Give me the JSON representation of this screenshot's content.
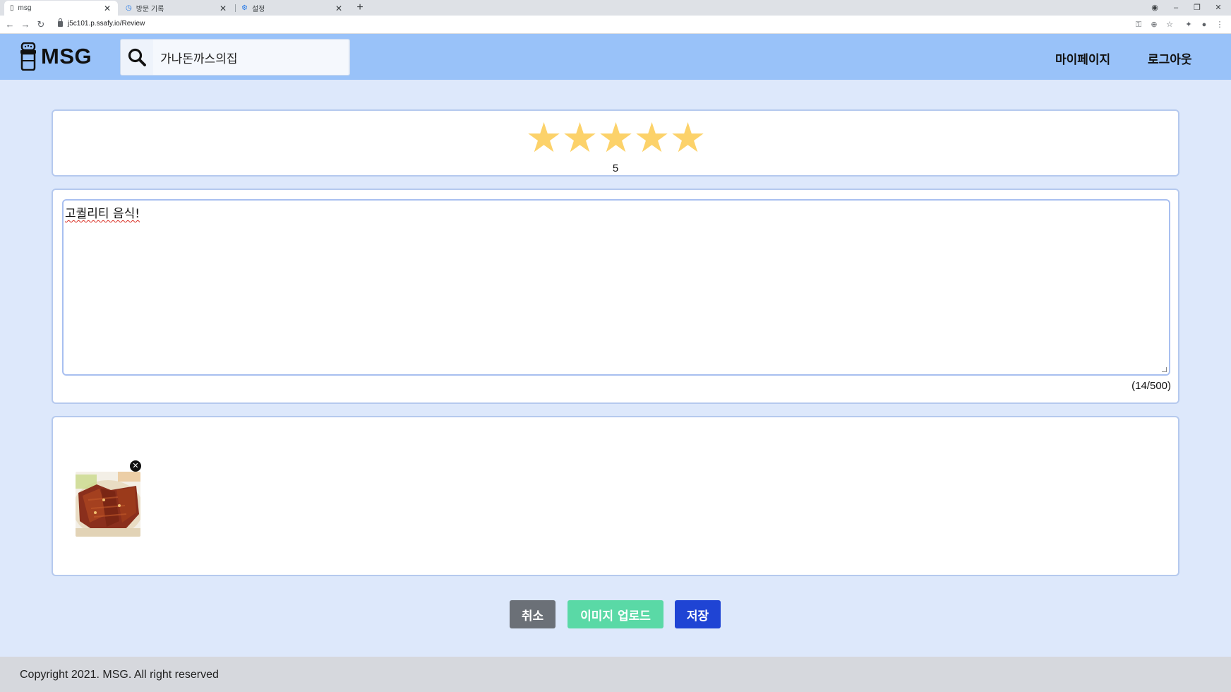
{
  "browser": {
    "tabs": [
      {
        "title": "msg",
        "active": true
      },
      {
        "title": "방문 기록",
        "active": false
      },
      {
        "title": "설정",
        "active": false
      }
    ],
    "url": "j5c101.p.ssafy.io/Review"
  },
  "header": {
    "logo_text": "MSG",
    "search_value": "가나돈까스의집",
    "nav": {
      "mypage": "마이페이지",
      "logout": "로그아웃"
    }
  },
  "review": {
    "rating": 5,
    "rating_label": "5",
    "stars_filled": 5,
    "stars_total": 5,
    "text": "고퀄리티 음식!",
    "char_count": "(14/500)",
    "images": [
      {
        "alt": "돈까스 사진"
      }
    ]
  },
  "buttons": {
    "cancel": "취소",
    "upload": "이미지 업로드",
    "save": "저장"
  },
  "footer": {
    "copyright": "Copyright 2021. MSG. All right reserved"
  },
  "colors": {
    "header_bg": "#99c2f9",
    "page_bg": "#dde8fb",
    "star": "#fcd26a",
    "cancel": "#6b7077",
    "upload": "#5ad9a6",
    "save": "#1f44d4"
  }
}
